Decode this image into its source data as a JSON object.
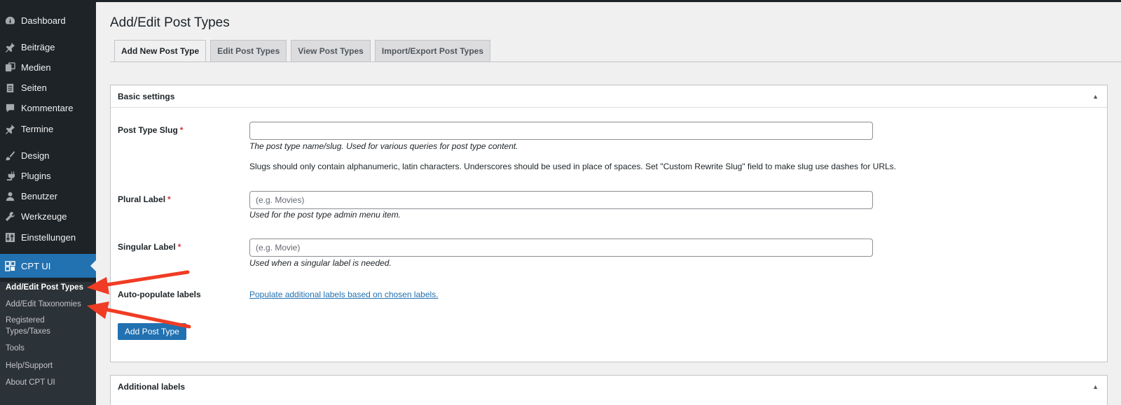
{
  "sidebar": {
    "items": [
      {
        "label": "Dashboard",
        "icon": "dashboard-icon"
      },
      {
        "label": "Beiträge",
        "icon": "pin-icon"
      },
      {
        "label": "Medien",
        "icon": "media-icon"
      },
      {
        "label": "Seiten",
        "icon": "pages-icon"
      },
      {
        "label": "Kommentare",
        "icon": "comment-icon"
      },
      {
        "label": "Termine",
        "icon": "pin-icon"
      },
      {
        "label": "Design",
        "icon": "brush-icon"
      },
      {
        "label": "Plugins",
        "icon": "plugin-icon"
      },
      {
        "label": "Benutzer",
        "icon": "user-icon"
      },
      {
        "label": "Werkzeuge",
        "icon": "wrench-icon"
      },
      {
        "label": "Einstellungen",
        "icon": "settings-icon"
      },
      {
        "label": "CPT UI",
        "icon": "grid-icon"
      }
    ],
    "submenu": [
      {
        "label": "Add/Edit Post Types"
      },
      {
        "label": "Add/Edit Taxonomies"
      },
      {
        "label": "Registered Types/Taxes"
      },
      {
        "label": "Tools"
      },
      {
        "label": "Help/Support"
      },
      {
        "label": "About CPT UI"
      }
    ]
  },
  "page": {
    "title": "Add/Edit Post Types",
    "tabs": [
      {
        "label": "Add New Post Type"
      },
      {
        "label": "Edit Post Types"
      },
      {
        "label": "View Post Types"
      },
      {
        "label": "Import/Export Post Types"
      }
    ]
  },
  "basic": {
    "title": "Basic settings",
    "toggle": "▲",
    "slug_label": "Post Type Slug",
    "slug_value": "",
    "slug_help": "The post type name/slug. Used for various queries for post type content.",
    "slug_note": "Slugs should only contain alphanumeric, latin characters. Underscores should be used in place of spaces. Set \"Custom Rewrite Slug\" field to make slug use dashes for URLs.",
    "plural_label": "Plural Label",
    "plural_placeholder": "(e.g. Movies)",
    "plural_help": "Used for the post type admin menu item.",
    "singular_label": "Singular Label",
    "singular_placeholder": "(e.g. Movie)",
    "singular_help": "Used when a singular label is needed.",
    "auto_label": "Auto-populate labels",
    "auto_link": "Populate additional labels based on chosen labels.",
    "submit": "Add Post Type",
    "required_mark": "*"
  },
  "additional": {
    "title": "Additional labels",
    "toggle": "▲"
  },
  "colors": {
    "accent": "#2271b1",
    "sidebar": "#1d2327",
    "annotation": "#f03c24"
  }
}
